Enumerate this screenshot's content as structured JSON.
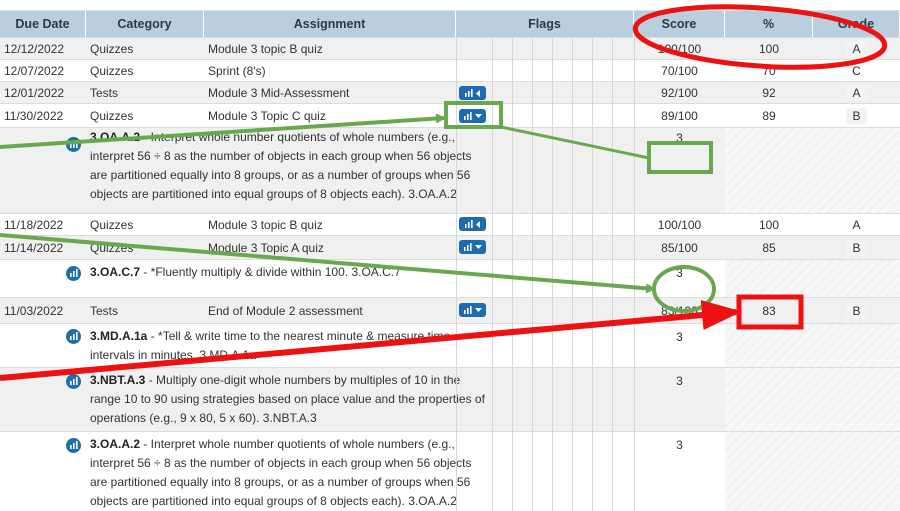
{
  "headers": {
    "due": "Due Date",
    "category": "Category",
    "assignment": "Assignment",
    "flags": "Flags",
    "score": "Score",
    "pct": "%",
    "grade": "Grade"
  },
  "rows": [
    {
      "due": "12/12/2022",
      "category": "Quizzes",
      "assignment": "Module 3 topic B quiz",
      "score": "100/100",
      "pct": "100",
      "grade": "A"
    },
    {
      "due": "12/07/2022",
      "category": "Quizzes",
      "assignment": "Sprint (8's)",
      "score": "70/100",
      "pct": "70",
      "grade": "C"
    },
    {
      "due": "12/01/2022",
      "category": "Tests",
      "assignment": "Module 3 Mid-Assessment",
      "score": "92/100",
      "pct": "92",
      "grade": "A"
    },
    {
      "due": "11/30/2022",
      "category": "Quizzes",
      "assignment": "Module 3 Topic C quiz",
      "score": "89/100",
      "pct": "89",
      "grade": "B"
    },
    {
      "due": "11/18/2022",
      "category": "Quizzes",
      "assignment": "Module 3 topic B quiz",
      "score": "100/100",
      "pct": "100",
      "grade": "A"
    },
    {
      "due": "11/14/2022",
      "category": "Quizzes",
      "assignment": "Module 3 Topic A quiz",
      "score": "85/100",
      "pct": "85",
      "grade": "B"
    },
    {
      "due": "11/03/2022",
      "category": "Tests",
      "assignment": "End of Module 2 assessment",
      "score": "83/100",
      "pct": "83",
      "grade": "B"
    }
  ],
  "standards": [
    {
      "code": "3.OA.A.2",
      "text": " - Interpret whole number quotients of whole numbers (e.g., interpret 56 ÷ 8 as the number of objects in each group when 56 objects are partitioned equally into 8 groups, or as a number of groups when 56 objects are partitioned into equal groups of 8 objects each). 3.OA.A.2",
      "score": "3"
    },
    {
      "code": "3.OA.C.7",
      "text": " - *Fluently multiply & divide within 100. 3.OA.C.7",
      "score": "3"
    },
    {
      "code": "3.MD.A.1a",
      "text": " - *Tell & write time to the nearest minute & measure time intervals in minutes. 3.MD.A.1a",
      "score": "3"
    },
    {
      "code": "3.NBT.A.3",
      "text": " - Multiply one-digit whole numbers by multiples of 10 in the range 10 to 90 using strategies based on place value and the properties of operations (e.g., 9 x 80, 5 x 60). 3.NBT.A.3",
      "score": "3"
    },
    {
      "code": "3.OA.A.2",
      "text": " - Interpret whole number quotients of whole numbers (e.g., interpret 56 ÷ 8 as the number of objects in each group when 56 objects are partitioned equally into 8 groups, or as a number of groups when 56 objects are partitioned into equal groups of 8 objects each). 3.OA.A.2",
      "score": "3"
    }
  ],
  "colors": {
    "header_bg": "#b9cfdf",
    "flag_button": "#1f6bb0",
    "annot_green": "#6aa84f",
    "annot_red": "#ee1111"
  }
}
